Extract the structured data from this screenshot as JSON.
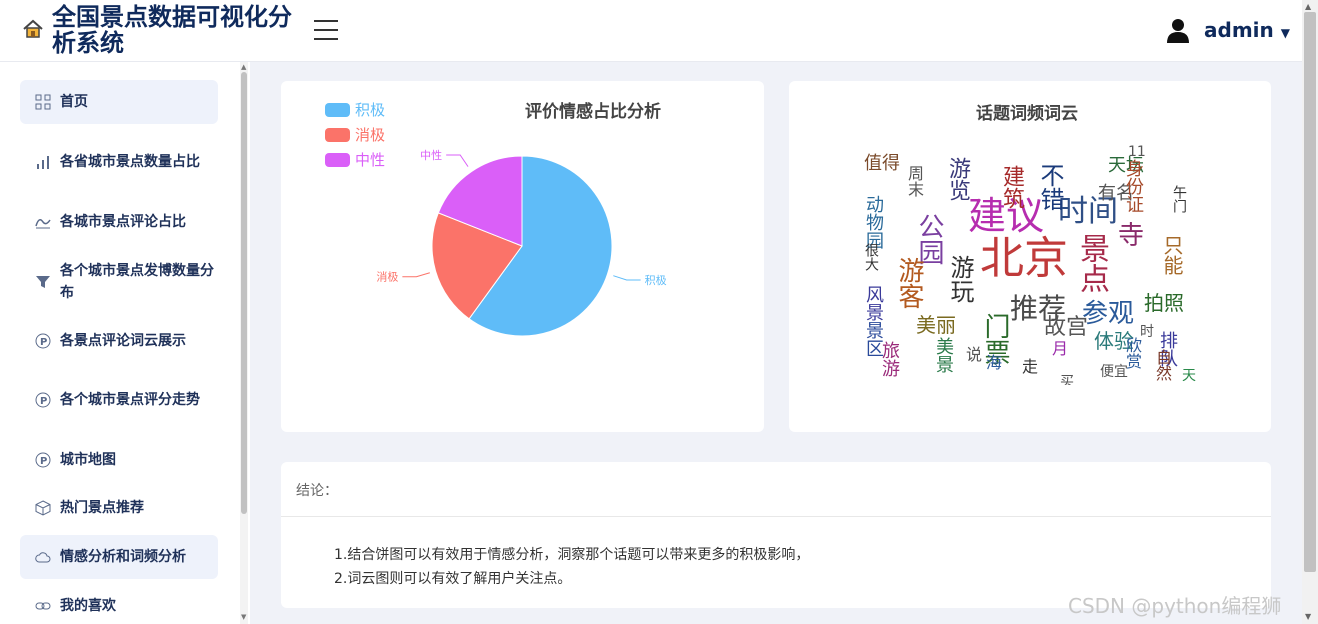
{
  "header": {
    "title": "全国景点数据可视化分析系统",
    "user": "admin",
    "icons": {
      "logo": "home-icon",
      "menu": "hamburger-icon",
      "user": "user-icon",
      "caret": "caret-down-icon"
    }
  },
  "sidebar": {
    "items": [
      {
        "label": "首页",
        "icon": "grid-icon"
      },
      {
        "label": "各省城市景点数量占比",
        "icon": "bar-chart-icon"
      },
      {
        "label": "各城市景点评论占比",
        "icon": "wave-icon"
      },
      {
        "label": "各个城市景点发博数量分布",
        "icon": "filter-icon"
      },
      {
        "label": "各景点评论词云展示",
        "icon": "p-circle-icon"
      },
      {
        "label": "各个城市景点评分走势",
        "icon": "p-circle-icon"
      },
      {
        "label": "城市地图",
        "icon": "p-circle-icon"
      },
      {
        "label": "热门景点推荐",
        "icon": "cube-icon"
      },
      {
        "label": "情感分析和词频分析",
        "icon": "cloud-icon"
      },
      {
        "label": "我的喜欢",
        "icon": "link-icon"
      }
    ]
  },
  "pie_card": {
    "title": "评价情感占比分析",
    "legend": [
      "积极",
      "消极",
      "中性"
    ]
  },
  "chart_data": {
    "type": "pie",
    "title": "评价情感占比分析",
    "categories": [
      "积极",
      "消极",
      "中性"
    ],
    "values": [
      60,
      21,
      19
    ],
    "colors": [
      "#5fbcf8",
      "#fb7369",
      "#da5ff8"
    ],
    "legend_position": "top-left"
  },
  "cloud_card": {
    "title": "话题词频词云",
    "words": [
      {
        "t": "北京",
        "c": "#c03a3a"
      },
      {
        "t": "建议",
        "c": "#b62daf"
      },
      {
        "t": "时间",
        "c": "#2f4f86"
      },
      {
        "t": "景点",
        "c": "#a62a4a"
      },
      {
        "t": "推荐",
        "c": "#4a4a4a"
      },
      {
        "t": "游玩",
        "c": "#333333"
      },
      {
        "t": "公园",
        "c": "#7a3fa0"
      },
      {
        "t": "门票",
        "c": "#2a6a2a"
      },
      {
        "t": "故宫",
        "c": "#555555"
      },
      {
        "t": "参观",
        "c": "#2a5a9a"
      },
      {
        "t": "游客",
        "c": "#b35a20"
      },
      {
        "t": "不错",
        "c": "#1a3a7a"
      },
      {
        "t": "美丽",
        "c": "#7a6a20"
      },
      {
        "t": "体验",
        "c": "#2a7a7a"
      },
      {
        "t": "拍照",
        "c": "#2a6a2a"
      },
      {
        "t": "游览",
        "c": "#3a3a7a"
      },
      {
        "t": "天坛",
        "c": "#2a6a3a"
      },
      {
        "t": "有名",
        "c": "#555555"
      },
      {
        "t": "建筑",
        "c": "#a62a2a"
      },
      {
        "t": "值得",
        "c": "#7a4a2a"
      },
      {
        "t": "动物园",
        "c": "#2a6a9a"
      },
      {
        "t": "周末",
        "c": "#555555"
      },
      {
        "t": "身份证",
        "c": "#a64a2a"
      },
      {
        "t": "寺",
        "c": "#8a2a6a"
      },
      {
        "t": "风景",
        "c": "#3a3a9a"
      },
      {
        "t": "美景",
        "c": "#2a7a4a"
      },
      {
        "t": "欣赏",
        "c": "#2a5a9a"
      },
      {
        "t": "排队",
        "c": "#3a3a9a"
      },
      {
        "t": "海",
        "c": "#2a5a9a"
      },
      {
        "t": "走",
        "c": "#333333"
      },
      {
        "t": "便宜",
        "c": "#555555"
      },
      {
        "t": "自然",
        "c": "#7a3a2a"
      },
      {
        "t": "只能",
        "c": "#a66a2a"
      },
      {
        "t": "景区",
        "c": "#2a4a9a"
      },
      {
        "t": "旅游",
        "c": "#9a2a7a"
      },
      {
        "t": "说",
        "c": "#555555"
      },
      {
        "t": "月",
        "c": "#9a2aaa"
      },
      {
        "t": "时",
        "c": "#555555"
      },
      {
        "t": "天",
        "c": "#2a8a4a"
      },
      {
        "t": "买",
        "c": "#555555"
      },
      {
        "t": "很大",
        "c": "#333333"
      },
      {
        "t": "11",
        "c": "#555555"
      },
      {
        "t": "午门",
        "c": "#333333"
      }
    ]
  },
  "conclusion": {
    "label": "结论：",
    "lines": [
      "1.结合饼图可以有效用于情感分析，洞察那个话题可以带来更多的积极影响，",
      "2.词云图则可以有效了解用户关注点。"
    ]
  },
  "watermark": "CSDN @python编程狮"
}
